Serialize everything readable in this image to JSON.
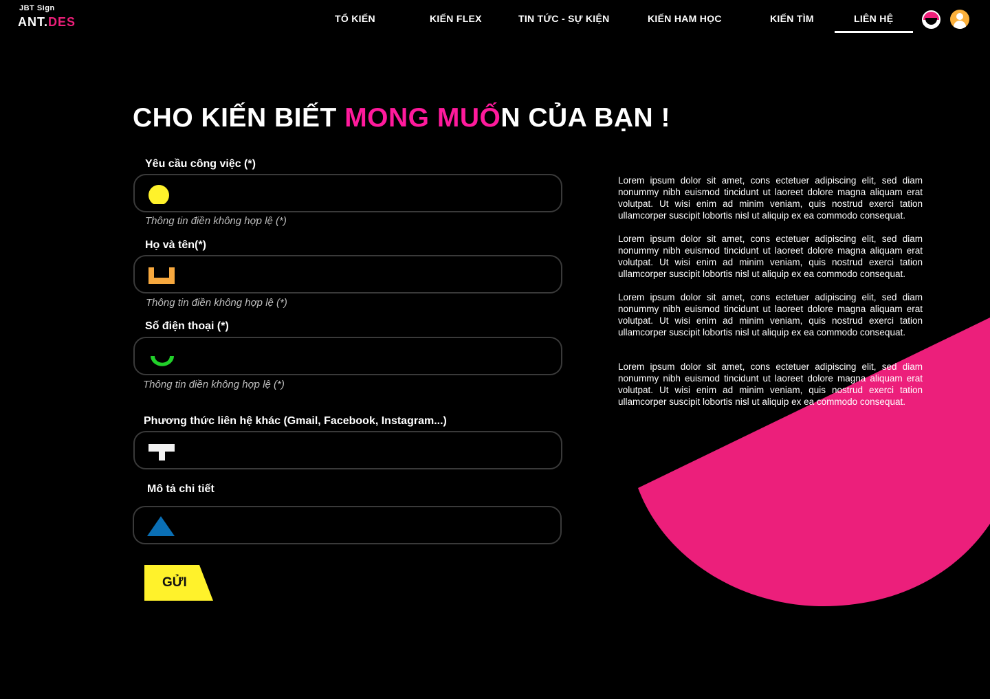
{
  "brand": {
    "logo_top": "JBT Sign",
    "logo_main_prefix": "ANT.",
    "logo_main_accent": "DES",
    "accent_color": "#ee1f7a"
  },
  "nav": {
    "items": [
      {
        "label": "TỔ KIẾN"
      },
      {
        "label": "KIẾN FLEX"
      },
      {
        "label": "TIN TỨC - SỰ KIỆN"
      },
      {
        "label": "KIẾN HAM HỌC"
      },
      {
        "label": "KIẾN TÌM"
      },
      {
        "label": "LIÊN HỆ",
        "active": true
      }
    ],
    "lang_icon": "language-toggle-icon",
    "user_icon": "user-avatar-icon"
  },
  "heading": {
    "part1": "CHO KIẾN BIẾT ",
    "highlight": "MONG MUỐ",
    "part2": "N CỦA BẠN !",
    "highlight_color": "#ff1a9c"
  },
  "form": {
    "fields": [
      {
        "label": "Yêu cầu công việc (*)",
        "value": "",
        "error": "Thông tin điền không hợp lệ (*)",
        "icon": "yellow-circle-icon"
      },
      {
        "label": "Họ và tên(*)",
        "value": "",
        "error": "Thông tin điền không hợp lệ (*)",
        "icon": "orange-bracket-icon"
      },
      {
        "label": "Số điện thoại (*)",
        "value": "",
        "error": "Thông tin điền không hợp lệ (*)",
        "icon": "green-arc-icon"
      },
      {
        "label": "Phương thức liên hệ khác (Gmail, Facebook, Instagram...)",
        "value": "",
        "icon": "white-t-icon"
      },
      {
        "label": "Mô tả chi tiết",
        "value": "",
        "icon": "blue-triangle-icon"
      }
    ],
    "submit_label": "GỬI",
    "submit_color": "#fff22b"
  },
  "info": {
    "paragraphs": [
      "Lorem ipsum dolor sit amet, cons ectetuer adipiscing elit, sed diam nonummy nibh euismod tincidunt ut laoreet dolore magna aliquam erat volutpat. Ut wisi enim ad minim veniam, quis nostrud exerci tation ullamcorper suscipit lobortis nisl ut aliquip ex ea commodo consequat.",
      "Lorem ipsum dolor sit amet, cons ectetuer adipiscing elit, sed diam nonummy nibh euismod tincidunt ut laoreet dolore magna aliquam erat volutpat. Ut wisi enim ad minim veniam, quis nostrud exerci tation ullamcorper suscipit lobortis nisl ut aliquip ex ea commodo consequat.",
      "Lorem ipsum dolor sit amet, cons ectetuer adipiscing elit, sed diam nonummy nibh euismod tincidunt ut laoreet dolore magna aliquam erat volutpat. Ut wisi enim ad minim veniam, quis nostrud exerci tation ullamcorper suscipit lobortis nisl ut aliquip ex ea commodo consequat.",
      "Lorem ipsum dolor sit amet, cons ectetuer adipiscing elit, sed diam nonummy nibh euismod tincidunt ut laoreet dolore magna aliquam erat volutpat. Ut wisi enim ad minim veniam, quis nostrud exerci tation ullamcorper suscipit lobortis nisl ut aliquip ex ea commodo consequat."
    ]
  },
  "decor": {
    "shape_color": "#ec1f7b"
  }
}
